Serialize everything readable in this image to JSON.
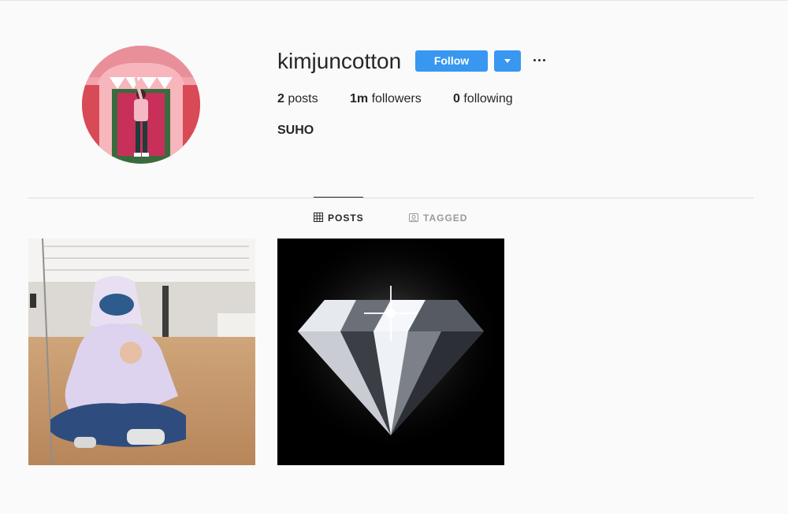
{
  "profile": {
    "username": "kimjuncotton",
    "full_name": "SUHO",
    "follow_label": "Follow"
  },
  "stats": {
    "posts_count": "2",
    "posts_label": "posts",
    "followers_count": "1m",
    "followers_label": "followers",
    "following_count": "0",
    "following_label": "following"
  },
  "tabs": {
    "posts": "POSTS",
    "tagged": "TAGGED"
  },
  "icons": {
    "dropdown": "chevron-down-icon",
    "more": "more-options-icon",
    "posts_tab": "grid-icon",
    "tagged_tab": "tag-icon"
  },
  "colors": {
    "accent": "#3897f0",
    "text": "#262626",
    "muted": "#999999",
    "background": "#fafafa"
  }
}
